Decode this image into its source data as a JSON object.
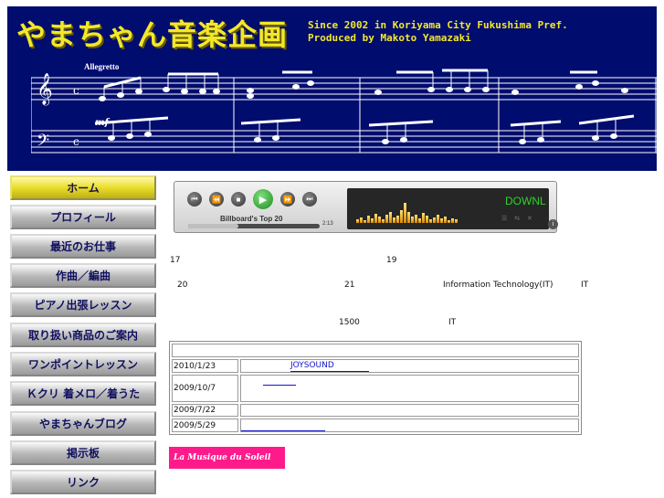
{
  "header": {
    "site_title": "やまちゃん音楽企画",
    "tagline_line1": "Since 2002 in Koriyama City Fukushima Pref.",
    "tagline_line2": "Produced by Makoto Yamazaki",
    "tempo_marking": "Allegretto"
  },
  "nav": {
    "items": [
      {
        "label": "ホーム",
        "active": true
      },
      {
        "label": "プロフィール"
      },
      {
        "label": "最近のお仕事"
      },
      {
        "label": "作曲／編曲"
      },
      {
        "label": "ピアノ出張レッスン"
      },
      {
        "label": "取り扱い商品のご案内"
      },
      {
        "label": "ワンポイントレッスン"
      },
      {
        "label": "Ｋクリ 着メロ／着うた"
      },
      {
        "label": "やまちゃんブログ"
      },
      {
        "label": "掲示板"
      },
      {
        "label": "リンク"
      }
    ]
  },
  "player": {
    "track_title": "Billboard's Top 20",
    "time": "2:13",
    "download_label": "DOWNL",
    "progress_fraction": 0.38,
    "icons": [
      "skip-back-icon",
      "rewind-icon",
      "stop-icon",
      "play-icon",
      "fast-forward-icon",
      "skip-forward-icon"
    ]
  },
  "content": {
    "line1_num_a": "17",
    "line1_num_b": "19",
    "line2_num_a": "20",
    "line2_num_b": "21",
    "line2_it_full": "Information Technology(IT)",
    "line2_it_short": "IT",
    "line3_num": "1500",
    "line3_it": "IT"
  },
  "news": {
    "header": "",
    "rows": [
      {
        "date": "2010/1/23",
        "text": "JOYSOUND"
      },
      {
        "date": "2009/10/7",
        "text": ""
      },
      {
        "date": "2009/7/22",
        "text": ""
      },
      {
        "date": "2009/5/29",
        "text": ""
      }
    ]
  },
  "banner": {
    "label": "La Musique du Soleil"
  }
}
